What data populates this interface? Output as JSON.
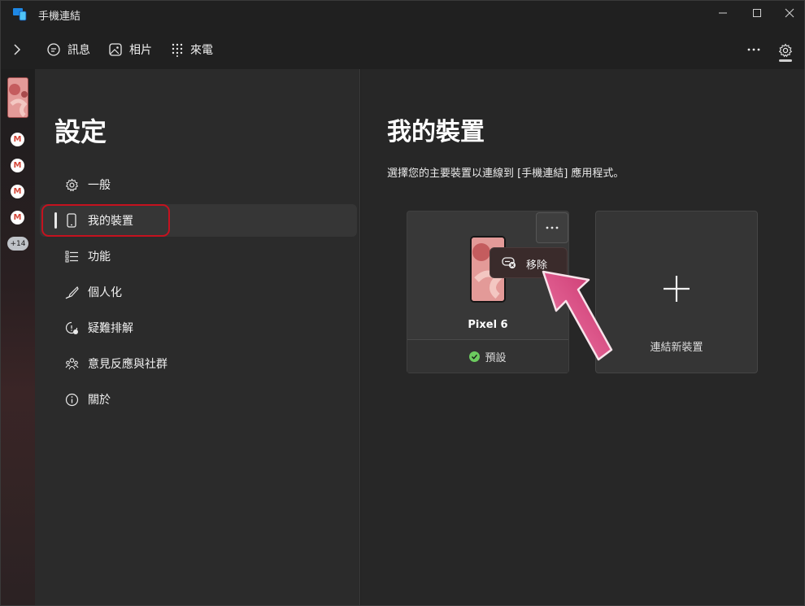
{
  "window": {
    "title": "手機連結",
    "icon": "phone-link-app-icon",
    "controls": [
      "minimize-icon",
      "maximize-icon",
      "close-icon"
    ]
  },
  "toolbar": {
    "collapse_icon": "chevron-right-icon",
    "tabs": [
      {
        "label": "訊息",
        "icon": "message-icon"
      },
      {
        "label": "相片",
        "icon": "photo-icon"
      },
      {
        "label": "來電",
        "icon": "dialpad-icon"
      }
    ],
    "more_icon": "more-horizontal-icon",
    "settings_icon": "gear-icon"
  },
  "rail": {
    "notification_count": "+14"
  },
  "settings": {
    "title": "設定",
    "menu": [
      {
        "label": "一般",
        "icon": "gear-icon"
      },
      {
        "label": "我的裝置",
        "icon": "phone-icon",
        "selected": true
      },
      {
        "label": "功能",
        "icon": "list-icon"
      },
      {
        "label": "個人化",
        "icon": "brush-icon"
      },
      {
        "label": "疑難排解",
        "icon": "troubleshoot-icon"
      },
      {
        "label": "意見反應與社群",
        "icon": "community-icon"
      },
      {
        "label": "關於",
        "icon": "info-icon"
      }
    ]
  },
  "main": {
    "title": "我的裝置",
    "description": "選擇您的主要裝置以連線到 [手機連結] 應用程式。",
    "device": {
      "name": "Pixel 6",
      "status": "預設",
      "more_icon": "more-horizontal-icon"
    },
    "context_menu": {
      "label": "移除",
      "icon": "unlink-device-icon"
    },
    "add_device_label": "連結新裝置"
  },
  "colors": {
    "background": "#202020",
    "highlight_box": "#c5121f",
    "arrow": "#d9437a",
    "status_ok": "#6ccb5f"
  }
}
